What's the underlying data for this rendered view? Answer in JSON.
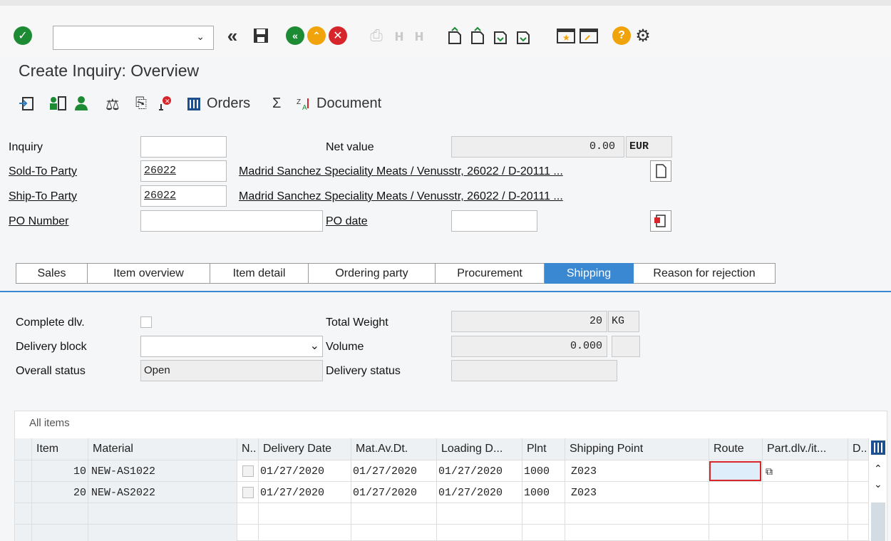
{
  "toolbar": {
    "command_value": "",
    "icons": [
      "check-icon",
      "back-double-icon",
      "save-icon",
      "back-icon",
      "exit-icon",
      "cancel-icon",
      "print-icon",
      "find-icon",
      "find-next-icon",
      "first-page-icon",
      "previous-page-icon",
      "next-page-icon",
      "last-page-icon",
      "create-session-icon",
      "shortcut-icon",
      "help-icon",
      "settings-icon"
    ]
  },
  "page": {
    "title": "Create Inquiry: Overview"
  },
  "app_toolbar": {
    "orders_label": "Orders",
    "document_label": "Document"
  },
  "header": {
    "inquiry_label": "Inquiry",
    "inquiry_value": "",
    "net_value_label": "Net value",
    "net_value": "0.00",
    "currency": "EUR",
    "sold_to_label": "Sold-To Party",
    "sold_to_value": "26022",
    "sold_to_desc": "Madrid Sanchez Speciality Meats / Venusstr, 26022 / D-20111 ...",
    "ship_to_label": "Ship-To Party",
    "ship_to_value": "26022",
    "ship_to_desc": "Madrid Sanchez Speciality Meats / Venusstr, 26022 / D-20111 ...",
    "po_number_label": "PO Number",
    "po_number_value": "",
    "po_date_label": "PO date",
    "po_date_value": ""
  },
  "tabs": [
    {
      "label": "Sales"
    },
    {
      "label": "Item overview"
    },
    {
      "label": "Item detail"
    },
    {
      "label": "Ordering party"
    },
    {
      "label": "Procurement"
    },
    {
      "label": "Shipping",
      "active": true
    },
    {
      "label": "Reason for rejection"
    }
  ],
  "shipping": {
    "complete_dlv_label": "Complete dlv.",
    "delivery_block_label": "Delivery block",
    "delivery_block_value": "",
    "overall_status_label": "Overall status",
    "overall_status_value": "Open",
    "total_weight_label": "Total Weight",
    "total_weight_value": "20",
    "weight_unit": "KG",
    "volume_label": "Volume",
    "volume_value": "0.000",
    "volume_unit": "",
    "delivery_status_label": "Delivery status",
    "delivery_status_value": ""
  },
  "items": {
    "title": "All items",
    "columns": [
      "Item",
      "Material",
      "N..",
      "Delivery Date",
      "Mat.Av.Dt.",
      "Loading D...",
      "Plnt",
      "Shipping Point",
      "Route",
      "Part.dlv./it...",
      "D.."
    ],
    "rows": [
      {
        "item": "10",
        "material": "NEW-AS1022",
        "delivery_date": "01/27/2020",
        "mat_av_dt": "01/27/2020",
        "loading_date": "01/27/2020",
        "plnt": "1000",
        "shipping_point": "Z023",
        "route": ""
      },
      {
        "item": "20",
        "material": "NEW-AS2022",
        "delivery_date": "01/27/2020",
        "mat_av_dt": "01/27/2020",
        "loading_date": "01/27/2020",
        "plnt": "1000",
        "shipping_point": "Z023",
        "route": ""
      }
    ]
  },
  "colors": {
    "accent": "#3a88d1",
    "ok_green": "#1d8a34",
    "warn_orange": "#f0a30a",
    "cancel_red": "#d6262b"
  }
}
